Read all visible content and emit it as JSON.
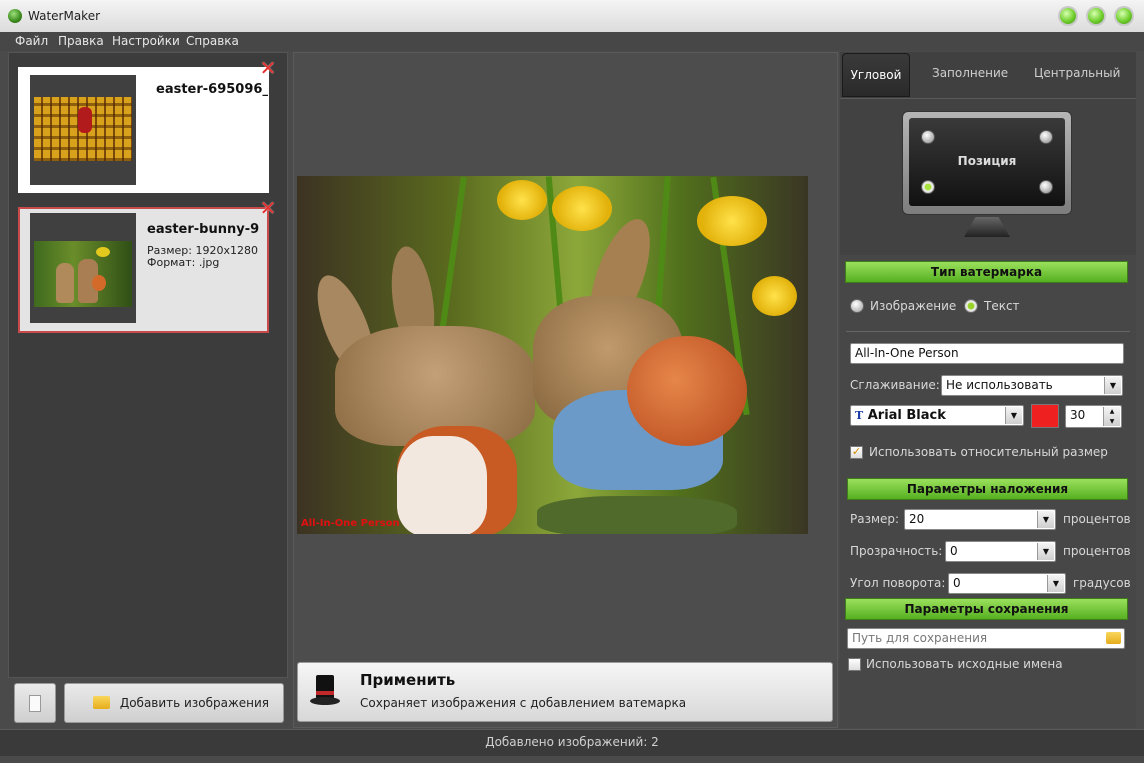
{
  "window": {
    "title": "WaterMaker"
  },
  "menu": {
    "items": [
      "Файл",
      "Правка",
      "Настройки",
      "Справка"
    ]
  },
  "images": [
    {
      "name": "easter-695096_...",
      "size": "",
      "format": ""
    },
    {
      "name": "easter-bunny-9...",
      "size": "Размер: 1920x1280",
      "format": "Формат: .jpg"
    }
  ],
  "left_buttons": {
    "add_images": "Добавить изображения"
  },
  "preview": {
    "watermark_text": "All-In-One Person"
  },
  "apply": {
    "title": "Применить",
    "description": "Сохраняет изображения с добавлением ватемарка"
  },
  "tabs": [
    "Угловой",
    "Заполнение",
    "Центральный"
  ],
  "position": {
    "label": "Позиция",
    "selected": "bottom-left"
  },
  "watermark_type": {
    "header": "Тип ватермарка",
    "options": [
      "Изображение",
      "Текст"
    ],
    "selected": "Текст"
  },
  "text_settings": {
    "text_value": "All-In-One Person",
    "smoothing_label": "Сглаживание:",
    "smoothing_value": "Не использовать",
    "font": "Arial Black",
    "font_size": "30",
    "color": "#ee2020",
    "relative_size_label": "Использовать относительный размер",
    "relative_size_checked": true
  },
  "overlay": {
    "header": "Параметры наложения",
    "size_label": "Размер:",
    "size_value": "20",
    "size_unit": "процентов",
    "opacity_label": "Прозрачность:",
    "opacity_value": "0",
    "opacity_unit": "процентов",
    "angle_label": "Угол поворота:",
    "angle_value": "0",
    "angle_unit": "градусов"
  },
  "save": {
    "header": "Параметры сохранения",
    "path_placeholder": "Путь для сохранения",
    "original_names_label": "Использовать исходные имена",
    "original_names_checked": false
  },
  "status": {
    "text": "Добавлено изображений: 2"
  },
  "colors": {
    "accent_green": "#6fcf2c",
    "delete_red": "#e23030",
    "selected_border": "#c84a4a"
  }
}
